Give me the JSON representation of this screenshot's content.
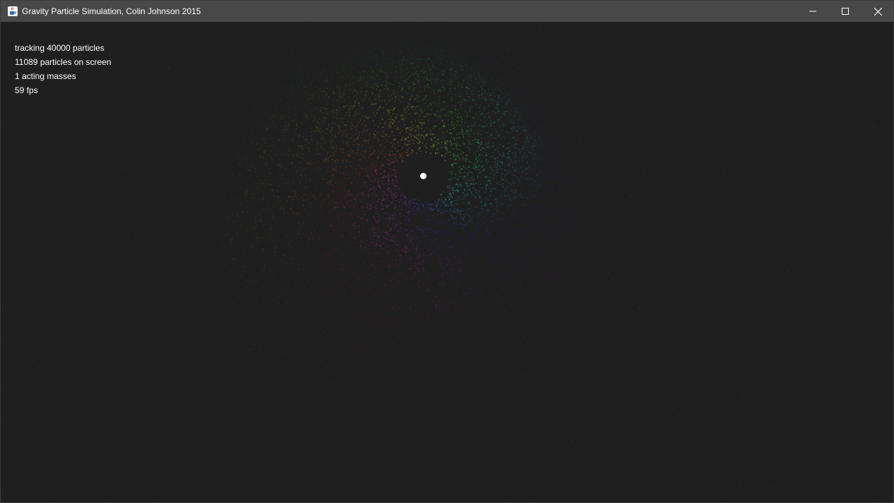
{
  "window": {
    "title": "Gravity Particle Simulation, Colin Johnson 2015",
    "app_icon": "java-cup-icon",
    "controls": {
      "minimize_icon": "minimize-icon",
      "maximize_icon": "maximize-icon",
      "close_icon": "close-icon"
    }
  },
  "hud": {
    "tracking": "tracking 40000 particles",
    "on_screen": "11089 particles on screen",
    "masses": "1 acting masses",
    "fps": "59 fps"
  },
  "simulation": {
    "particles_tracked": 40000,
    "particles_on_screen": 11089,
    "acting_masses": 1,
    "fps": 59
  },
  "colors": {
    "background": "#1f1f1f",
    "titlebar": "#484848",
    "text": "#ffffff",
    "mass": "#ffffff"
  }
}
